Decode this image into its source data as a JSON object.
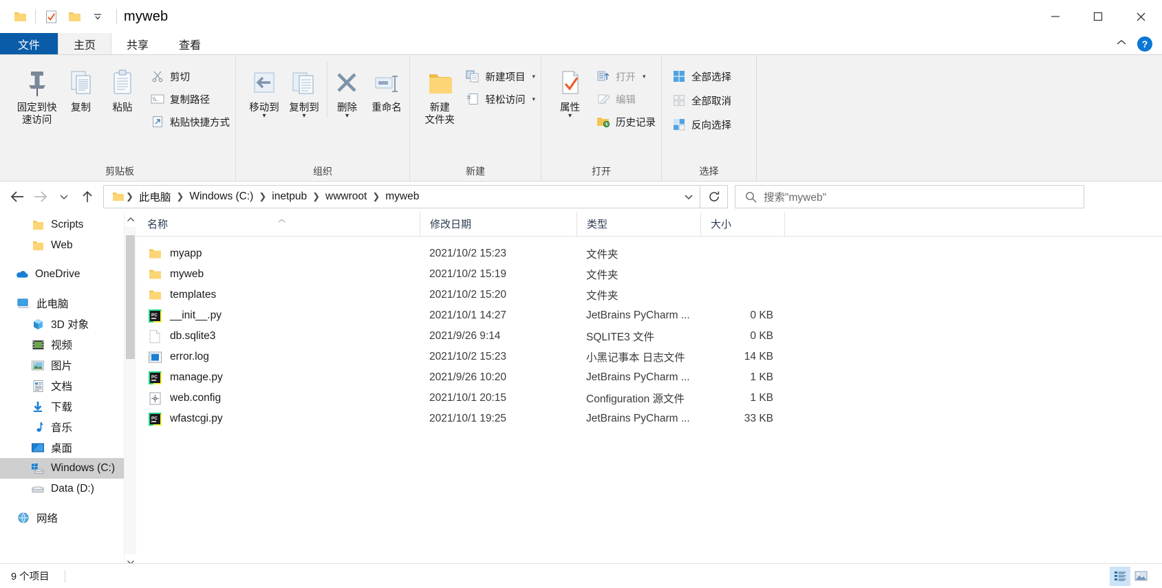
{
  "window": {
    "title": "myweb",
    "quick_access": [
      "folder-icon",
      "properties-icon",
      "new-folder-icon",
      "customize-dropdown"
    ],
    "controls": {
      "minimize": "minimize-icon",
      "maximize": "maximize-icon",
      "close": "close-icon"
    }
  },
  "ribbon": {
    "tabs": [
      {
        "label": "文件",
        "name": "tab-file"
      },
      {
        "label": "主页",
        "name": "tab-home"
      },
      {
        "label": "共享",
        "name": "tab-share"
      },
      {
        "label": "查看",
        "name": "tab-view"
      }
    ],
    "collapse_icon": "chevron-up-icon",
    "help_icon": "?",
    "groups": [
      {
        "label": "剪贴板",
        "big": [
          {
            "label": "固定到快\n速访问",
            "line1": "固定到快",
            "line2": "速访问",
            "icon": "pin-icon"
          },
          {
            "label": "复制",
            "icon": "copy-icon"
          },
          {
            "label": "粘贴",
            "icon": "paste-icon"
          }
        ],
        "small": [
          {
            "label": "剪切",
            "icon": "scissors-icon"
          },
          {
            "label": "复制路径",
            "icon": "copy-path-icon"
          },
          {
            "label": "粘贴快捷方式",
            "icon": "paste-shortcut-icon"
          }
        ]
      },
      {
        "label": "组织",
        "big": [
          {
            "label": "移动到",
            "icon": "move-to-icon",
            "has_caret": true
          },
          {
            "label": "复制到",
            "icon": "copy-to-icon",
            "has_caret": true
          },
          {
            "label": "删除",
            "icon": "delete-icon",
            "has_caret": true
          },
          {
            "label": "重命名",
            "icon": "rename-icon"
          }
        ]
      },
      {
        "label": "新建",
        "big": [
          {
            "line1": "新建",
            "line2": "文件夹",
            "label": "新建文件夹",
            "icon": "new-folder-icon"
          }
        ],
        "small": [
          {
            "label": "新建项目",
            "icon": "new-item-icon",
            "has_caret": true
          },
          {
            "label": "轻松访问",
            "icon": "easy-access-icon",
            "has_caret": true
          }
        ]
      },
      {
        "label": "打开",
        "big": [
          {
            "label": "属性",
            "icon": "properties-icon",
            "has_caret": true
          }
        ],
        "small": [
          {
            "label": "打开",
            "icon": "open-icon",
            "has_caret": true,
            "dim": true
          },
          {
            "label": "编辑",
            "icon": "edit-icon",
            "dim": true
          },
          {
            "label": "历史记录",
            "icon": "history-icon"
          }
        ]
      },
      {
        "label": "选择",
        "small": [
          {
            "label": "全部选择",
            "icon": "select-all-icon"
          },
          {
            "label": "全部取消",
            "icon": "select-none-icon"
          },
          {
            "label": "反向选择",
            "icon": "invert-selection-icon"
          }
        ]
      }
    ]
  },
  "address": {
    "back_icon": "arrow-left-icon",
    "forward_icon": "arrow-right-icon",
    "recent_icon": "chevron-down-icon",
    "up_icon": "arrow-up-icon",
    "crumbs": [
      "此电脑",
      "Windows (C:)",
      "inetpub",
      "wwwroot",
      "myweb"
    ],
    "dropdown_icon": "chevron-down-icon",
    "refresh_icon": "refresh-icon",
    "search_placeholder": "搜索\"myweb\"",
    "search_icon": "search-icon"
  },
  "sidebar": {
    "items": [
      {
        "label": "Scripts",
        "icon": "folder-icon",
        "indent": 2,
        "selected": false
      },
      {
        "label": "Web",
        "icon": "folder-icon",
        "indent": 2,
        "selected": false
      },
      {
        "label": "OneDrive",
        "icon": "onedrive-icon",
        "indent": 0,
        "selected": false,
        "gap_before": true
      },
      {
        "label": "此电脑",
        "icon": "this-pc-icon",
        "indent": 0,
        "selected": false,
        "gap_before": true
      },
      {
        "label": "3D 对象",
        "icon": "3d-objects-icon",
        "indent": 1,
        "selected": false
      },
      {
        "label": "视频",
        "icon": "videos-icon",
        "indent": 1,
        "selected": false
      },
      {
        "label": "图片",
        "icon": "pictures-icon",
        "indent": 1,
        "selected": false
      },
      {
        "label": "文档",
        "icon": "documents-icon",
        "indent": 1,
        "selected": false
      },
      {
        "label": "下载",
        "icon": "downloads-icon",
        "indent": 1,
        "selected": false
      },
      {
        "label": "音乐",
        "icon": "music-icon",
        "indent": 1,
        "selected": false
      },
      {
        "label": "桌面",
        "icon": "desktop-icon",
        "indent": 1,
        "selected": false
      },
      {
        "label": "Windows (C:)",
        "icon": "drive-windows-icon",
        "indent": 1,
        "selected": true
      },
      {
        "label": "Data (D:)",
        "icon": "drive-icon",
        "indent": 1,
        "selected": false
      },
      {
        "label": "网络",
        "icon": "network-icon",
        "indent": 0,
        "selected": false,
        "gap_before": true
      }
    ],
    "scroll_up_icon": "chevron-up-icon",
    "scroll_down_icon": "chevron-down-icon"
  },
  "filelist": {
    "columns": [
      {
        "label": "名称",
        "name": "column-name",
        "sorted": "asc"
      },
      {
        "label": "修改日期",
        "name": "column-date-modified"
      },
      {
        "label": "类型",
        "name": "column-type"
      },
      {
        "label": "大小",
        "name": "column-size"
      }
    ],
    "rows": [
      {
        "name": "myapp",
        "date": "2021/10/2 15:23",
        "type": "文件夹",
        "size": "",
        "icon": "folder-icon"
      },
      {
        "name": "myweb",
        "date": "2021/10/2 15:19",
        "type": "文件夹",
        "size": "",
        "icon": "folder-icon"
      },
      {
        "name": "templates",
        "date": "2021/10/2 15:20",
        "type": "文件夹",
        "size": "",
        "icon": "folder-icon"
      },
      {
        "name": "__init__.py",
        "date": "2021/10/1 14:27",
        "type": "JetBrains PyCharm ...",
        "size": "0 KB",
        "icon": "pycharm-icon"
      },
      {
        "name": "db.sqlite3",
        "date": "2021/9/26 9:14",
        "type": "SQLITE3 文件",
        "size": "0 KB",
        "icon": "blank-file-icon"
      },
      {
        "name": "error.log",
        "date": "2021/10/2 15:23",
        "type": "小黑记事本 日志文件",
        "size": "14 KB",
        "icon": "log-file-icon"
      },
      {
        "name": "manage.py",
        "date": "2021/9/26 10:20",
        "type": "JetBrains PyCharm ...",
        "size": "1 KB",
        "icon": "pycharm-icon"
      },
      {
        "name": "web.config",
        "date": "2021/10/1 20:15",
        "type": "Configuration 源文件",
        "size": "1 KB",
        "icon": "config-file-icon"
      },
      {
        "name": "wfastcgi.py",
        "date": "2021/10/1 19:25",
        "type": "JetBrains PyCharm ...",
        "size": "33 KB",
        "icon": "pycharm-icon"
      }
    ]
  },
  "statusbar": {
    "item_count": "9 个项目",
    "view_details_icon": "details-view-icon",
    "view_large_icon": "large-icons-view-icon"
  },
  "colors": {
    "accent": "#0a5ca8",
    "folder": "#f5c451",
    "selection": "#cde3f7",
    "ribbon_bg": "#f2f2f2"
  }
}
